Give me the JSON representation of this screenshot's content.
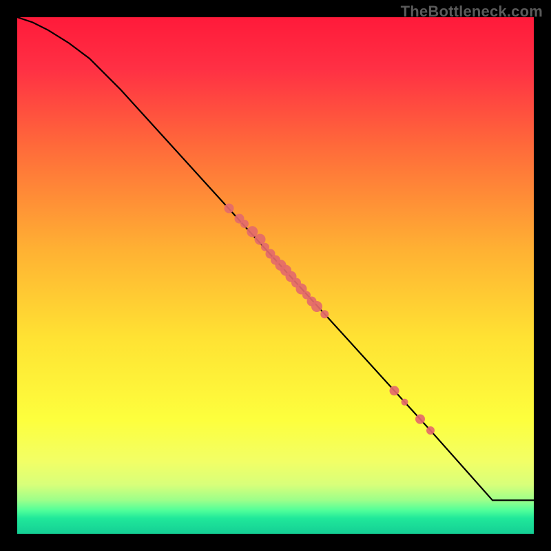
{
  "watermark": "TheBottleneck.com",
  "chart_data": {
    "type": "line",
    "title": "",
    "xlabel": "",
    "ylabel": "",
    "xlim": [
      0,
      100
    ],
    "ylim": [
      0,
      100
    ],
    "background_gradient": {
      "stops": [
        {
          "offset": 0.0,
          "color": "#ff1a3a"
        },
        {
          "offset": 0.1,
          "color": "#ff3044"
        },
        {
          "offset": 0.25,
          "color": "#ff6a3a"
        },
        {
          "offset": 0.45,
          "color": "#ffb133"
        },
        {
          "offset": 0.62,
          "color": "#ffe233"
        },
        {
          "offset": 0.78,
          "color": "#fdff3d"
        },
        {
          "offset": 0.86,
          "color": "#f2ff66"
        },
        {
          "offset": 0.905,
          "color": "#d8ff7a"
        },
        {
          "offset": 0.935,
          "color": "#9cff8a"
        },
        {
          "offset": 0.955,
          "color": "#4fff9a"
        },
        {
          "offset": 0.97,
          "color": "#20e89a"
        },
        {
          "offset": 1.0,
          "color": "#14cf95"
        }
      ]
    },
    "series": [
      {
        "name": "curve",
        "type": "line",
        "color": "#000000",
        "x": [
          0,
          3,
          6,
          10,
          14,
          20,
          30,
          40,
          50,
          60,
          70,
          80,
          88,
          92,
          100
        ],
        "y": [
          100,
          99,
          97.5,
          95,
          92,
          86,
          75,
          64,
          53,
          42,
          31,
          20,
          11,
          6.5,
          6.5
        ]
      },
      {
        "name": "points",
        "type": "scatter",
        "color": "#e46a6a",
        "points": [
          {
            "x": 41,
            "y": 63,
            "r": 7
          },
          {
            "x": 43,
            "y": 61,
            "r": 7
          },
          {
            "x": 44,
            "y": 60,
            "r": 6
          },
          {
            "x": 45.5,
            "y": 58.5,
            "r": 8
          },
          {
            "x": 47,
            "y": 57,
            "r": 8
          },
          {
            "x": 48,
            "y": 55.5,
            "r": 6
          },
          {
            "x": 49,
            "y": 54.2,
            "r": 7
          },
          {
            "x": 50,
            "y": 53,
            "r": 7
          },
          {
            "x": 51,
            "y": 52,
            "r": 8
          },
          {
            "x": 52,
            "y": 51,
            "r": 8
          },
          {
            "x": 53,
            "y": 49.8,
            "r": 8
          },
          {
            "x": 54,
            "y": 48.6,
            "r": 7
          },
          {
            "x": 55,
            "y": 47.4,
            "r": 8
          },
          {
            "x": 56,
            "y": 46.2,
            "r": 6
          },
          {
            "x": 57,
            "y": 45,
            "r": 7
          },
          {
            "x": 58,
            "y": 44,
            "r": 8
          },
          {
            "x": 59.5,
            "y": 42.5,
            "r": 6
          },
          {
            "x": 73,
            "y": 27.7,
            "r": 7
          },
          {
            "x": 75,
            "y": 25.5,
            "r": 5
          },
          {
            "x": 78,
            "y": 22.2,
            "r": 7
          },
          {
            "x": 80,
            "y": 20,
            "r": 6
          }
        ]
      }
    ]
  }
}
